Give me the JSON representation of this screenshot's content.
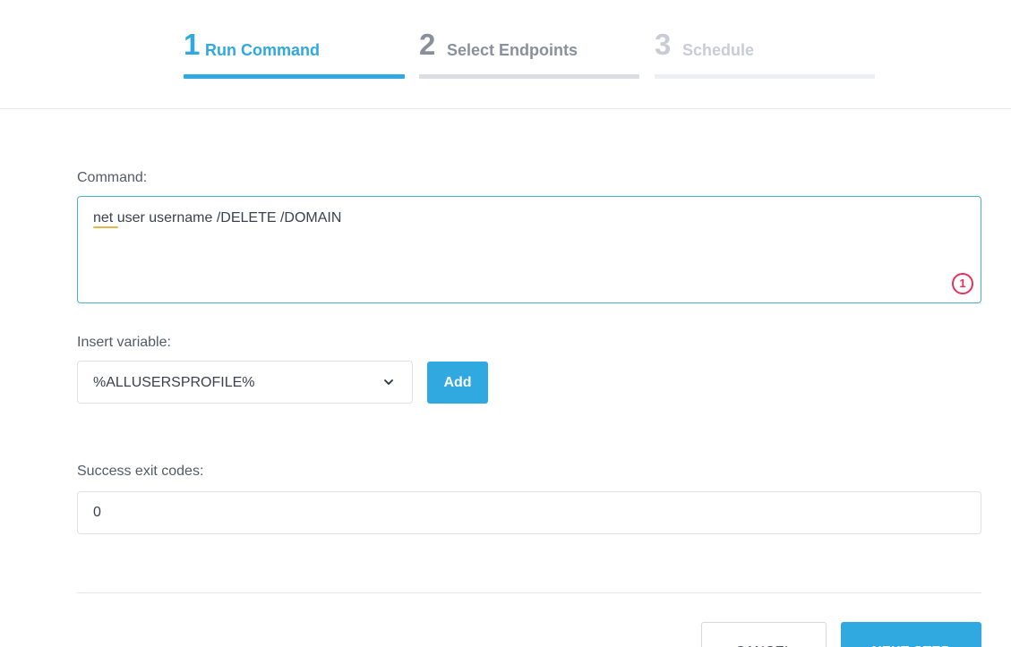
{
  "stepper": {
    "steps": [
      {
        "number": "1",
        "label": "Run Command",
        "state": "active"
      },
      {
        "number": "2",
        "label": "Select Endpoints",
        "state": "next"
      },
      {
        "number": "3",
        "label": "Schedule",
        "state": "disabled"
      }
    ]
  },
  "command": {
    "label": "Command:",
    "value": "net user username /DELETE /DOMAIN",
    "error_count": "1"
  },
  "insert_variable": {
    "label": "Insert variable:",
    "selected": "%ALLUSERSPROFILE%",
    "add_label": "Add"
  },
  "exit_codes": {
    "label": "Success exit codes:",
    "value": "0"
  },
  "footer": {
    "cancel_label": "CANCEL",
    "next_label": "NEXT STEP"
  },
  "colors": {
    "accent": "#30a8e0",
    "error": "#e8305c",
    "spellcheck": "#e5b54a"
  },
  "icons": {
    "select_arrow": "chevron-down-icon"
  }
}
